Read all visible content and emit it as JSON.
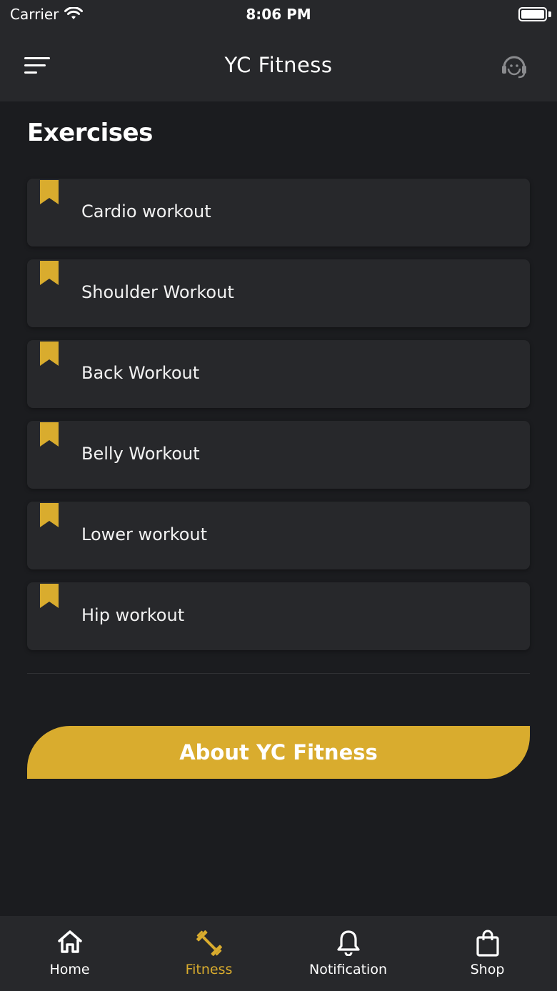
{
  "status_bar": {
    "carrier": "Carrier",
    "time": "8:06 PM"
  },
  "header": {
    "title": "YC Fitness",
    "menu_icon": "menu-icon",
    "support_icon": "headset-icon"
  },
  "section": {
    "title": "Exercises"
  },
  "exercises": [
    {
      "label": "Cardio workout"
    },
    {
      "label": "Shoulder Workout"
    },
    {
      "label": "Back Workout"
    },
    {
      "label": "Belly Workout"
    },
    {
      "label": "Lower workout"
    },
    {
      "label": "Hip workout"
    }
  ],
  "about_button": {
    "label": "About YC Fitness"
  },
  "tabs": [
    {
      "label": "Home",
      "icon": "home-icon",
      "active": false
    },
    {
      "label": "Fitness",
      "icon": "dumbbell-icon",
      "active": true
    },
    {
      "label": "Notification",
      "icon": "bell-icon",
      "active": false
    },
    {
      "label": "Shop",
      "icon": "shopping-bag-icon",
      "active": false
    }
  ],
  "colors": {
    "accent": "#d9ac2e",
    "background": "#1b1c1f",
    "surface": "#27282b"
  }
}
